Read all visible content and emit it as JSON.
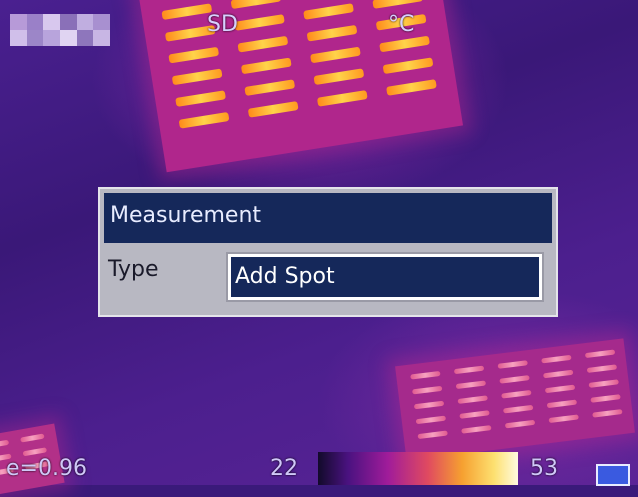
{
  "osd": {
    "storage_label": "SD",
    "unit_label": "°C"
  },
  "dialog": {
    "title": "Measurement",
    "field_label": "Type",
    "field_value": "Add Spot"
  },
  "status_bar": {
    "emissivity": "e=0.96",
    "scale_min": "22",
    "scale_max": "53"
  },
  "colors": {
    "dialog_title_bg": "#15285a",
    "dialog_bg": "#b8b8c2",
    "palette": "ironbow"
  },
  "icons": {
    "mode": "display-mode-icon",
    "logo": "brand-logo-pixels"
  }
}
